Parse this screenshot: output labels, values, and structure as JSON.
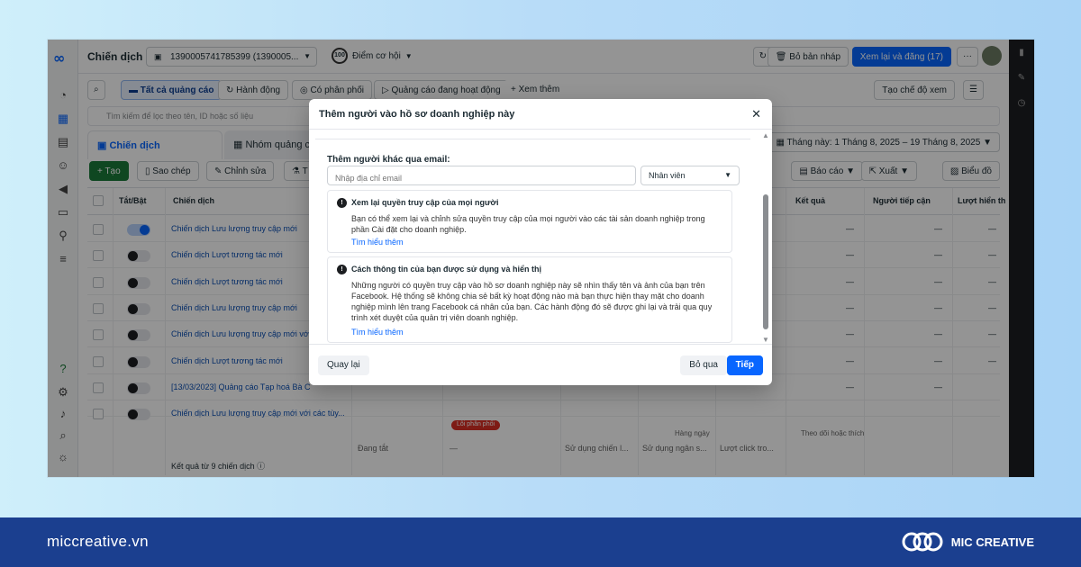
{
  "topbar": {
    "title": "Chiến dịch",
    "account": "1390005741785399 (1390005...",
    "opportunity_score": "100",
    "opportunity_label": "Điểm cơ hội",
    "draft_button": "Bỏ bản nháp",
    "review_publish_button": "Xem lại và đăng (17)",
    "more_button": "···"
  },
  "filters": {
    "all_ads": "Tất cả quảng cáo",
    "actions": "Hành động",
    "delivering": "Có phân phối",
    "active_ads": "Quảng cáo đang hoạt động",
    "more": "+ Xem thêm",
    "create_view": "Tạo chế độ xem",
    "search_placeholder": "Tìm kiếm để lọc theo tên, ID hoặc số liệu"
  },
  "tabs": {
    "campaigns": "Chiến dịch",
    "adsets": "Nhóm quảng c"
  },
  "daterange": "Tháng này: 1 Tháng 8, 2025 – 19 Tháng 8, 2025",
  "actions": {
    "create": "+ Tạo",
    "duplicate": "Sao chép",
    "edit": "Chỉnh sửa",
    "t": "T",
    "reports": "Báo cáo",
    "export": "Xuất",
    "charts": "Biểu đồ"
  },
  "table": {
    "headers": {
      "toggle": "Tắt/Bật",
      "campaign": "Chiến dịch",
      "results": "Kết quả",
      "reach": "Người tiếp cận",
      "impressions": "Lượt hiển th"
    },
    "rows": [
      {
        "name": "Chiến dịch Lưu lượng truy cập mới",
        "on": true
      },
      {
        "name": "Chiến dịch Lượt tương tác mới",
        "on": false
      },
      {
        "name": "Chiến dịch Lượt tương tác mới",
        "on": false
      },
      {
        "name": "Chiến dịch Lưu lượng truy cập mới",
        "on": false
      },
      {
        "name": "Chiến dịch Lưu lượng truy cập mới với",
        "on": false
      },
      {
        "name": "Chiến dịch Lượt tương tác mới",
        "on": false
      },
      {
        "name": "[13/03/2023] Quảng cáo Tạp hoá Bà C",
        "on": false
      },
      {
        "name": "Chiến dịch Lưu lượng truy cập mới với các tùy...",
        "on": false
      }
    ],
    "row7_extra": {
      "daily": "Hàng ngày",
      "track": "Theo dõi hoặc thích",
      "error_badge": "Lỗi phân phối"
    },
    "row8_cells": {
      "status": "Đang tắt",
      "dash": "—",
      "strategy": "Sử dụng chiến l...",
      "budget": "Sử dụng ngân s...",
      "link_clicks": "Lượt click tro..."
    },
    "dash": "—",
    "footer_total": "Kết quả từ 9 chiến dịch"
  },
  "modal": {
    "title": "Thêm người vào hồ sơ doanh nghiệp này",
    "email_section_label": "Thêm người khác qua email:",
    "email_placeholder": "Nhập địa chỉ email",
    "role_value": "Nhân viên",
    "box1_title": "Xem lại quyền truy cập của mọi người",
    "box1_text": "Bạn có thể xem lại và chỉnh sửa quyền truy cập của mọi người vào các tài sản doanh nghiệp trong phần Cài đặt cho doanh nghiệp.",
    "box1_link": "Tìm hiểu thêm",
    "box2_title": "Cách thông tin của bạn được sử dụng và hiển thị",
    "box2_text": "Những người có quyền truy cập vào hồ sơ doanh nghiệp này sẽ nhìn thấy tên và ảnh của bạn trên Facebook. Hệ thống sẽ không chia sẻ bất kỳ hoạt động nào mà bạn thực hiện thay mặt cho doanh nghiệp mình lên trang Facebook cá nhân của bạn. Các hành động đó sẽ được ghi lại và trải qua quy trình xét duyệt của quản trị viên doanh nghiệp.",
    "box2_link": "Tìm hiểu thêm",
    "back_button": "Quay lại",
    "skip_button": "Bỏ qua",
    "next_button": "Tiếp"
  },
  "brand": {
    "url": "miccreative.vn",
    "name": "MIC CREATIVE"
  },
  "colors": {
    "accent": "#0866ff",
    "brand_bar": "#1b3f8f",
    "create_green": "#1b7a3a"
  }
}
